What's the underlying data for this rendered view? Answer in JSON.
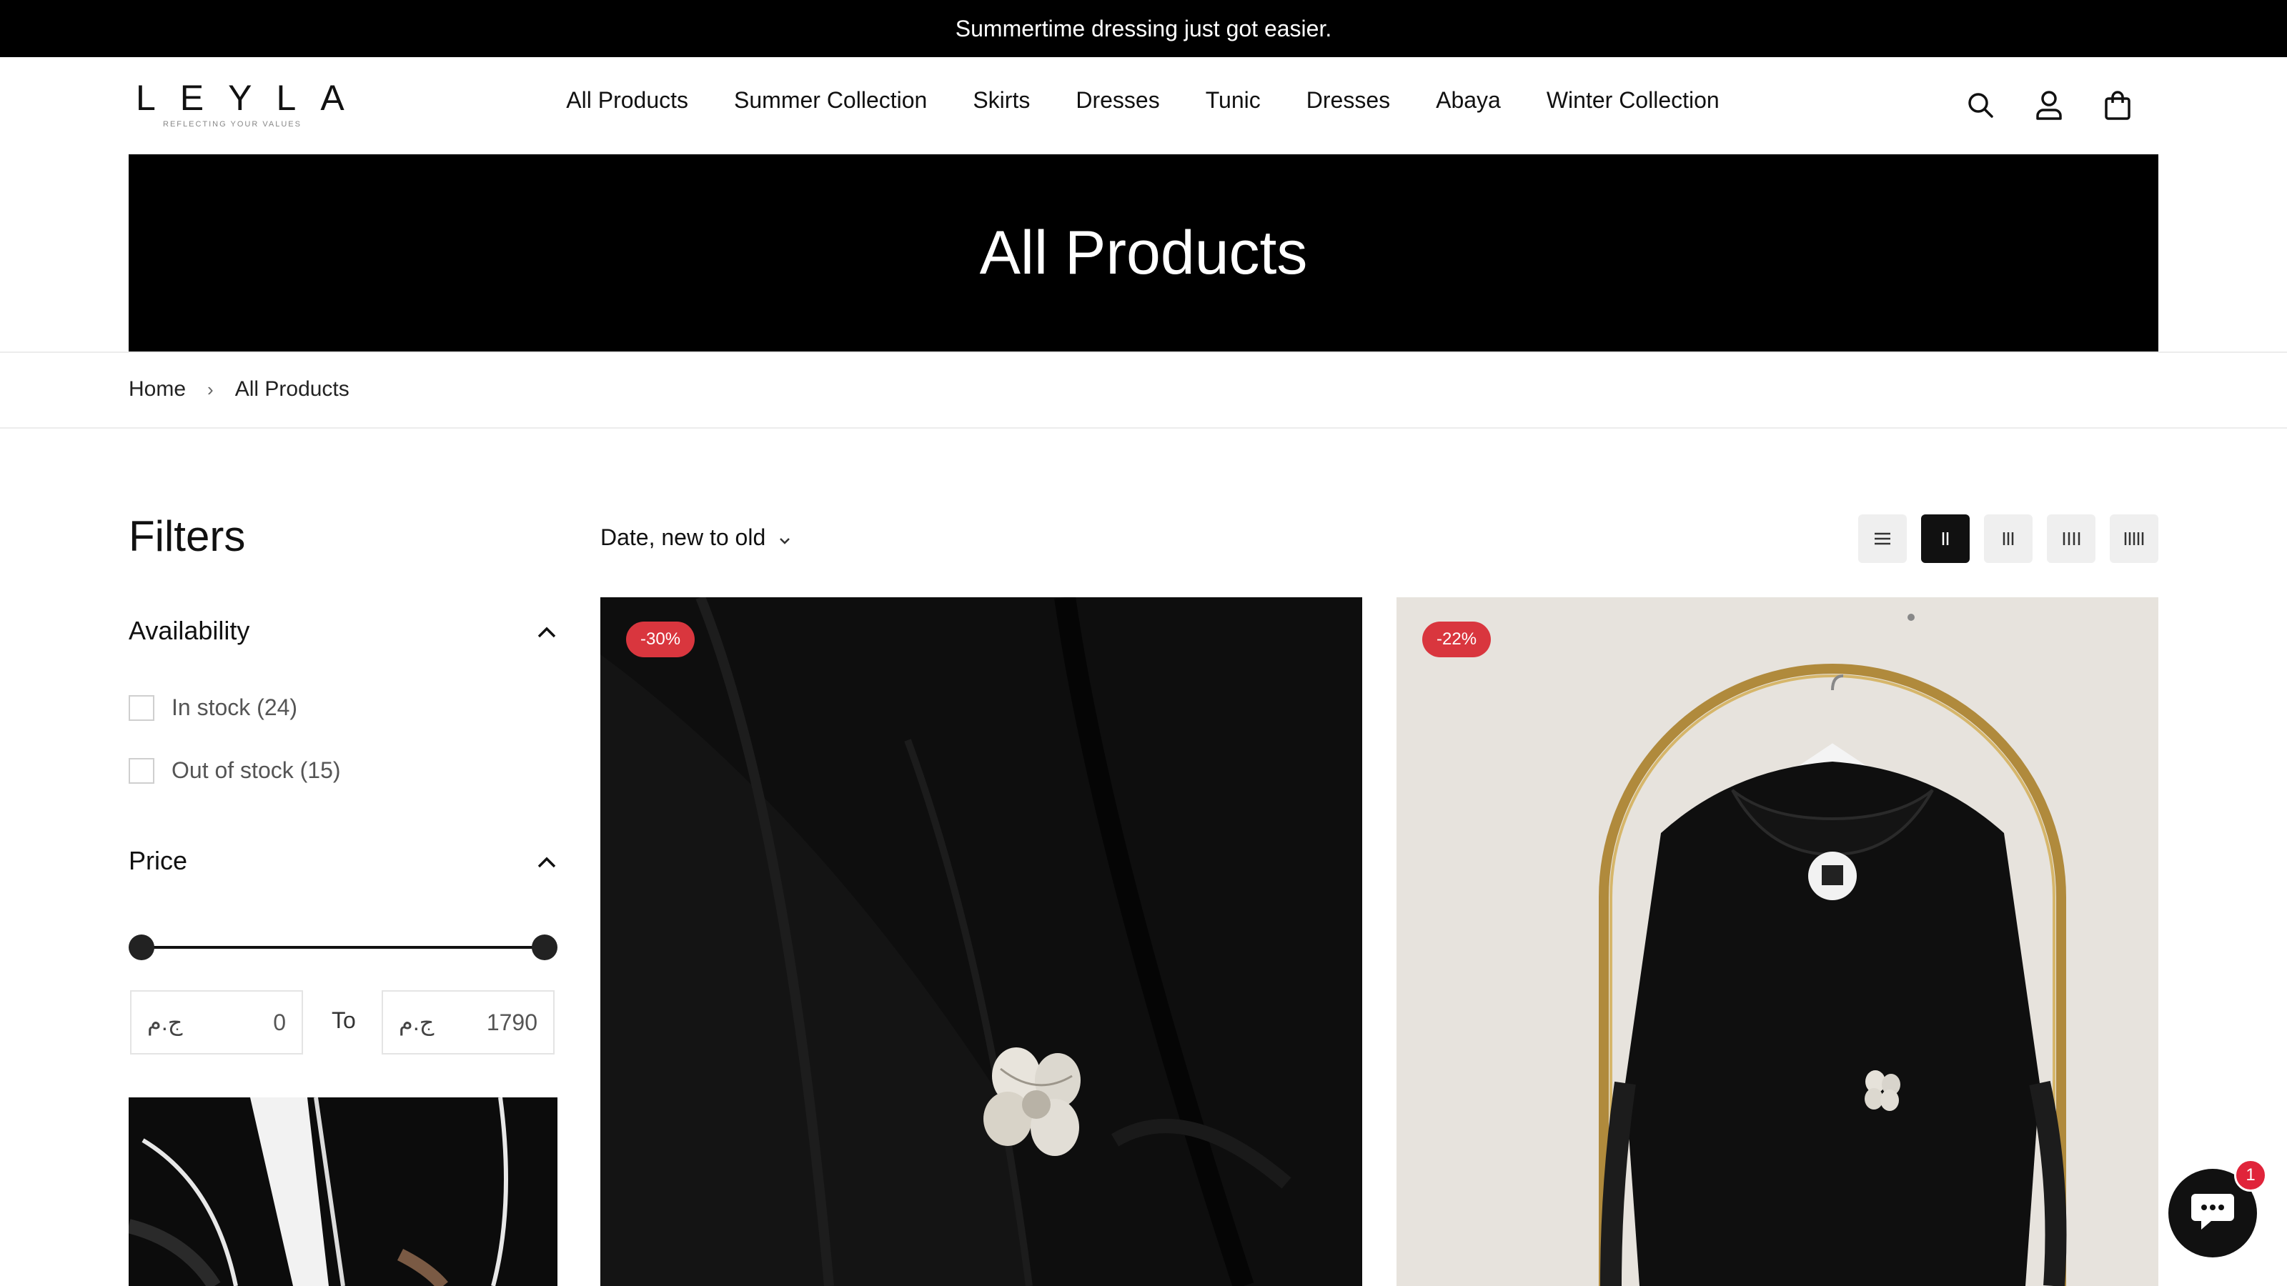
{
  "announcement": {
    "text": "Summertime dressing just got easier."
  },
  "brand": {
    "name": "LEYLA",
    "tagline": "REFLECTING YOUR VALUES"
  },
  "nav": {
    "items": [
      {
        "label": "All Products"
      },
      {
        "label": "Summer Collection"
      },
      {
        "label": "Skirts"
      },
      {
        "label": "Dresses"
      },
      {
        "label": "Tunic"
      },
      {
        "label": "Dresses"
      },
      {
        "label": "Abaya"
      },
      {
        "label": "Winter Collection"
      }
    ]
  },
  "header_icons": [
    "search-icon",
    "account-icon",
    "cart-icon"
  ],
  "hero": {
    "title": "All Products"
  },
  "breadcrumb": {
    "home": "Home",
    "current": "All Products"
  },
  "filters": {
    "title": "Filters",
    "availability": {
      "label": "Availability",
      "options": [
        {
          "label": "In stock (24)"
        },
        {
          "label": "Out of stock (15)"
        }
      ]
    },
    "price": {
      "label": "Price",
      "currency": "ج.م",
      "min_value": "0",
      "max_value": "1790",
      "to_label": "To"
    }
  },
  "toolbar": {
    "sort_label": "Date, new to old",
    "layouts": [
      "list",
      "2-columns",
      "3-columns",
      "4-columns",
      "5-columns"
    ],
    "active_layout": "2-columns"
  },
  "products": [
    {
      "badge": "-30%"
    },
    {
      "badge": "-22%"
    }
  ],
  "chat": {
    "unread": "1"
  },
  "colors": {
    "accent": "#000000",
    "sale_badge": "#d9363e",
    "chat_badge": "#e0243a"
  }
}
